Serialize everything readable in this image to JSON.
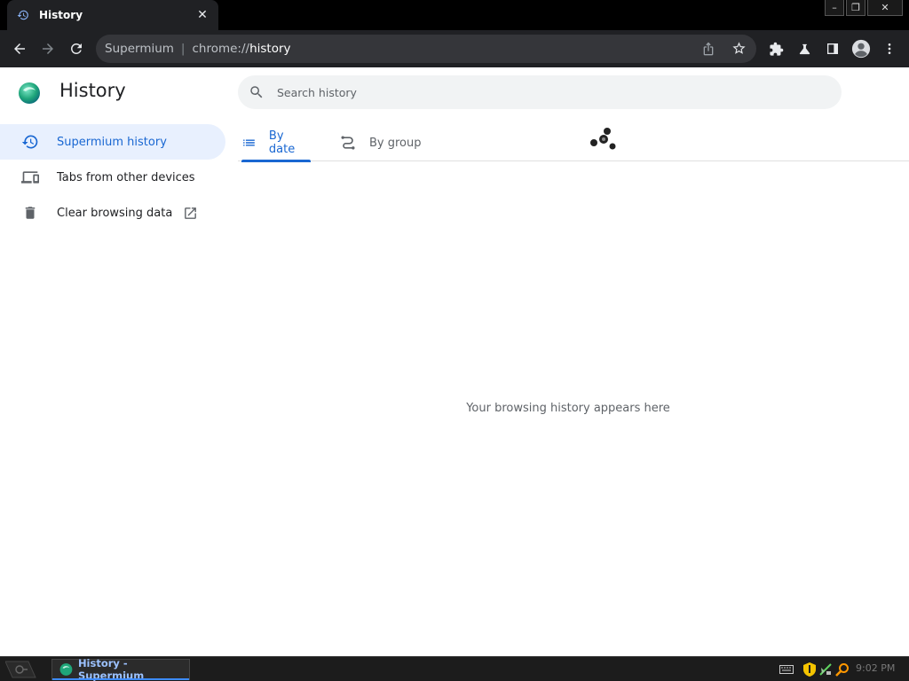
{
  "browser": {
    "tab": {
      "title": "History",
      "close_glyph": "✕"
    },
    "window_controls": {
      "minimize": "–",
      "restore": "❐",
      "close": "✕"
    },
    "address": {
      "site_label": "Supermium",
      "separator": "|",
      "scheme": "chrome://",
      "path": "history"
    }
  },
  "page": {
    "title": "History",
    "search_placeholder": "Search history",
    "nav": [
      {
        "label": "Supermium history",
        "icon": "history-icon",
        "active": true
      },
      {
        "label": "Tabs from other devices",
        "icon": "devices-icon",
        "active": false
      },
      {
        "label": "Clear browsing data",
        "icon": "trash-icon",
        "active": false
      }
    ],
    "view_tabs": [
      {
        "label": "By date",
        "icon": "list-icon",
        "active": true
      },
      {
        "label": "By group",
        "icon": "group-icon",
        "active": false
      }
    ],
    "empty_message": "Your browsing history appears here"
  },
  "taskbar": {
    "task_label": "History - Supermium",
    "clock": "9:02 PM"
  },
  "colors": {
    "accent": "#1967d2",
    "active_nav_bg": "#e8f0fe",
    "toolbar_bg": "#202124",
    "omnibox_bg": "#35363a"
  }
}
